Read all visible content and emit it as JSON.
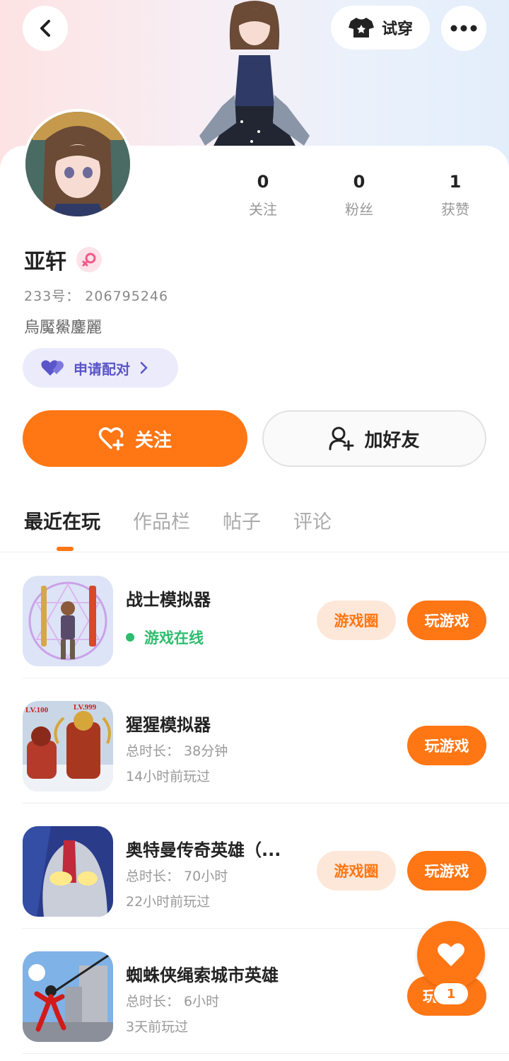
{
  "header": {
    "try_on_label": "试穿",
    "icons": {
      "back": "chevron-left-icon",
      "try_on": "shirt-icon",
      "more": "more-dots-icon"
    }
  },
  "profile": {
    "stats": [
      {
        "value": "0",
        "label": "关注"
      },
      {
        "value": "0",
        "label": "粉丝"
      },
      {
        "value": "1",
        "label": "获赞"
      }
    ],
    "name": "亚轩",
    "gender": "female",
    "uid": "233号： 206795246",
    "bio": "烏魘鱟鏖麗",
    "pair_label": "申请配对",
    "follow_label": "关注",
    "add_friend_label": "加好友"
  },
  "tabs": [
    "最近在玩",
    "作品栏",
    "帖子",
    "评论"
  ],
  "active_tab": 0,
  "games": [
    {
      "title": "战士模拟器",
      "status": "游戏在线",
      "online": true,
      "circle_label": "游戏圈",
      "play_label": "玩游戏"
    },
    {
      "title": "猩猩模拟器",
      "duration": "总时长： 38分钟",
      "last_played": "14小时前玩过",
      "play_label": "玩游戏",
      "icon_labels": [
        "LV.100",
        "LV.999"
      ]
    },
    {
      "title": "奥特曼传奇英雄（...",
      "duration": "总时长： 70小时",
      "last_played": "22小时前玩过",
      "circle_label": "游戏圈",
      "play_label": "玩游戏"
    },
    {
      "title": "蜘蛛侠绳索城市英雄",
      "duration": "总时长： 6小时",
      "last_played": "3天前玩过",
      "play_label": "玩"
    }
  ],
  "like_fab": {
    "count": "1",
    "icon": "heart-icon"
  },
  "colors": {
    "accent": "#ff7614",
    "online": "#2dbd6e",
    "pair": "#5a55c8"
  }
}
